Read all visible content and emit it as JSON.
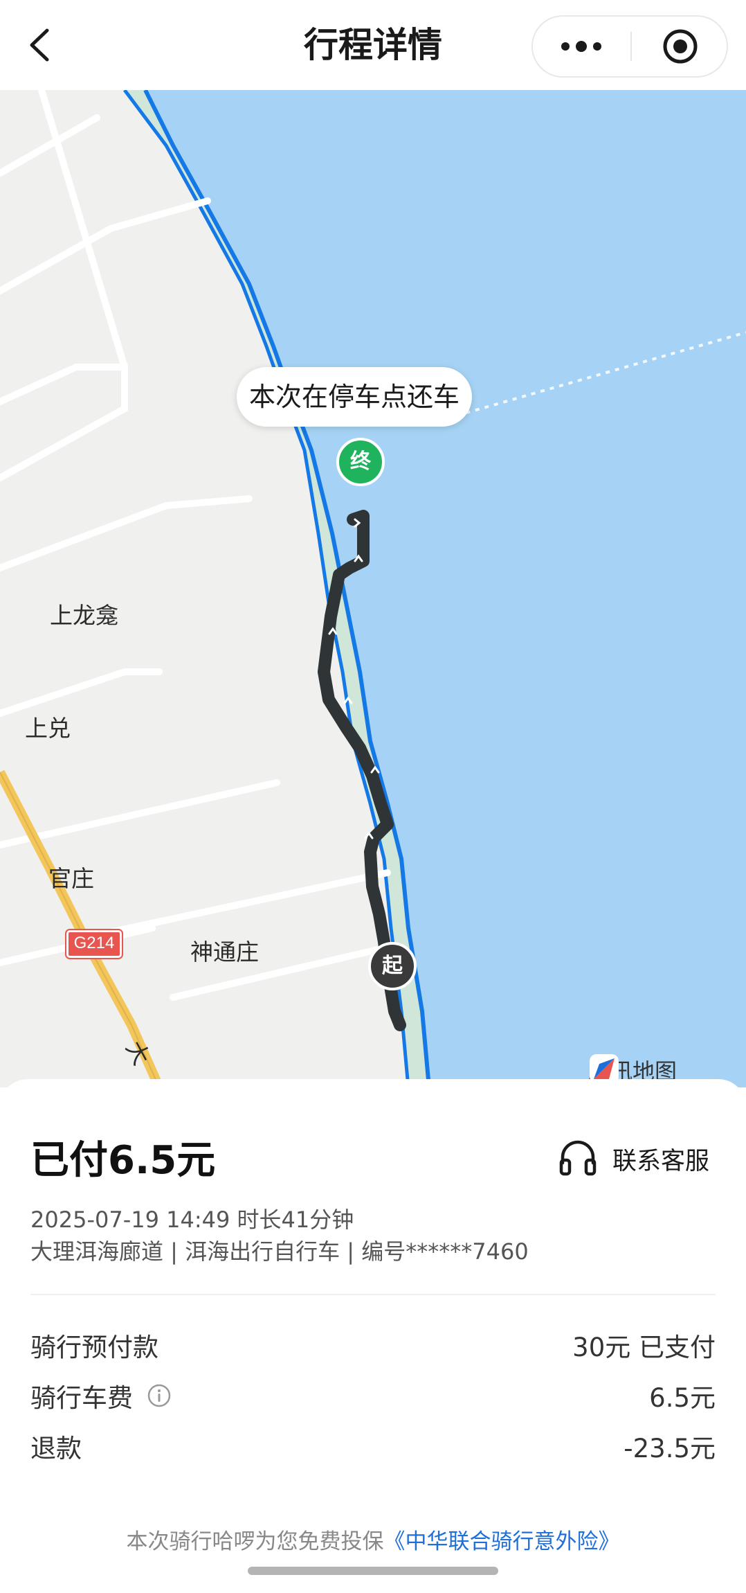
{
  "header": {
    "title": "行程详情"
  },
  "map": {
    "end_bubble": "本次在停车点还车",
    "end_marker": "终",
    "start_marker": "起",
    "places": [
      "上龙龛",
      "上兑",
      "官庄",
      "神通庄",
      "大"
    ],
    "highway_shield": "G214",
    "brand": "腾讯地图"
  },
  "panel": {
    "paid": "已付6.5元",
    "customer_service": "联系客服",
    "datetime_duration": "2025-07-19 14:49 时长41分钟",
    "route_info": "大理洱海廊道 | 洱海出行自行车 | 编号******7460",
    "fees": [
      {
        "label": "骑行预付款",
        "value": "30元 已支付"
      },
      {
        "label": "骑行车费",
        "value": "6.5元"
      },
      {
        "label": "退款",
        "value": "-23.5元"
      }
    ],
    "footer_text": "本次骑行哈啰为您免费投保",
    "footer_link": "《中华联合骑行意外险》"
  },
  "colors": {
    "water": "#a6d3f5",
    "shore_line": "#1478e6",
    "route": "#2f3437",
    "end_marker": "#1fb35e",
    "link": "#1e6fd9"
  }
}
